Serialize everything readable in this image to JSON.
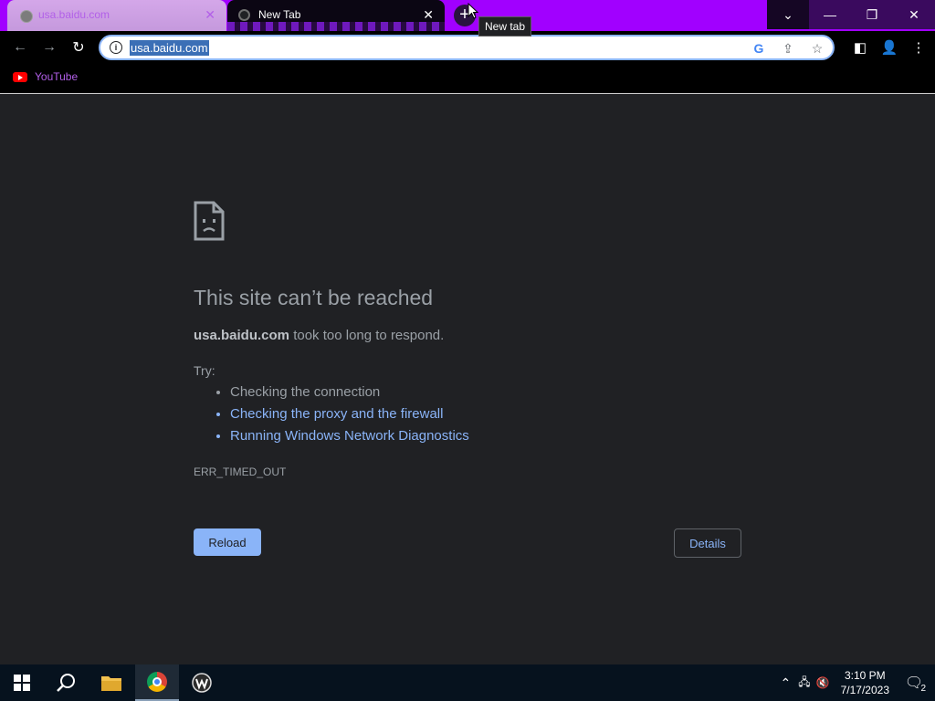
{
  "browser": {
    "tabs": [
      {
        "title": "usa.baidu.com",
        "active": false
      },
      {
        "title": "New Tab",
        "active": true
      }
    ],
    "new_tab_tooltip": "New tab",
    "new_tab_symbol": "+",
    "address_bar": {
      "url": "usa.baidu.com"
    },
    "bookmarks": [
      {
        "label": "YouTube"
      }
    ]
  },
  "error_page": {
    "title": "This site can’t be reached",
    "host": "usa.baidu.com",
    "description_suffix": " took too long to respond.",
    "try_label": "Try:",
    "suggestions": [
      {
        "text": "Checking the connection",
        "link": false
      },
      {
        "text": "Checking the proxy and the firewall",
        "link": true
      },
      {
        "text": "Running Windows Network Diagnostics",
        "link": true
      }
    ],
    "error_code": "ERR_TIMED_OUT",
    "reload_label": "Reload",
    "details_label": "Details"
  },
  "taskbar": {
    "time": "3:10 PM",
    "date": "7/17/2023",
    "notification_count": "2"
  },
  "colors": {
    "titlebar": "#a100ff",
    "page_bg": "#202124",
    "link": "#8ab4f8",
    "button_primary": "#8ab4f8"
  }
}
